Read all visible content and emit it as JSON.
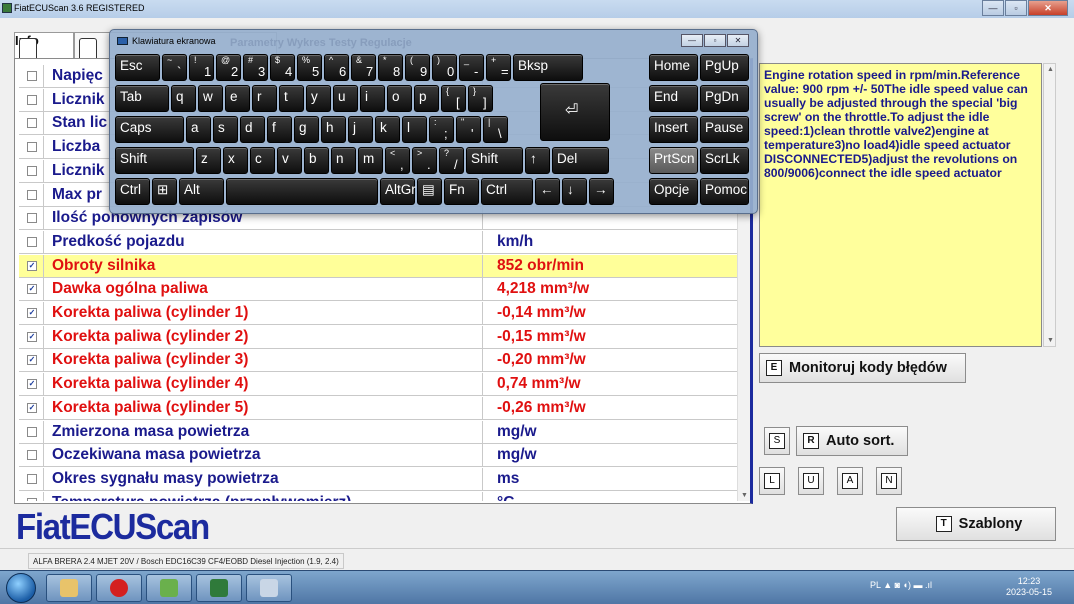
{
  "window": {
    "title": "FiatECUScan 3.6 REGISTERED",
    "controls": {
      "minimize": "—",
      "maximize": "▫",
      "close": "✕"
    }
  },
  "tabs": [
    {
      "key": "F2",
      "label": "Info"
    },
    {
      "key": "F3",
      "label": ""
    }
  ],
  "ghost_tabs": "Parametry   Wykres   Testy   Regulacje",
  "table": {
    "rows": [
      {
        "checked": false,
        "name": "Napięc",
        "value": ""
      },
      {
        "checked": false,
        "name": "Licznik",
        "value": ""
      },
      {
        "checked": false,
        "name": "Stan lic",
        "value": ""
      },
      {
        "checked": false,
        "name": "Liczba",
        "value": ""
      },
      {
        "checked": false,
        "name": "Licznik",
        "value": ""
      },
      {
        "checked": false,
        "name": "Max pr",
        "value": ""
      },
      {
        "checked": false,
        "name": "Ilość ponownych zapisów",
        "value": ""
      },
      {
        "checked": false,
        "name": "Predkość pojazdu",
        "value": "km/h"
      },
      {
        "checked": true,
        "name": "Obroty silnika",
        "value": "852 obr/min",
        "selected": true
      },
      {
        "checked": true,
        "name": "Dawka ogólna paliwa",
        "value": "4,218 mm³/w"
      },
      {
        "checked": true,
        "name": "Korekta paliwa (cylinder 1)",
        "value": "-0,14 mm³/w"
      },
      {
        "checked": true,
        "name": "Korekta paliwa (cylinder 2)",
        "value": "-0,15 mm³/w"
      },
      {
        "checked": true,
        "name": "Korekta paliwa (cylinder 3)",
        "value": "-0,20 mm³/w"
      },
      {
        "checked": true,
        "name": "Korekta paliwa (cylinder 4)",
        "value": "0,74 mm³/w"
      },
      {
        "checked": true,
        "name": "Korekta paliwa (cylinder 5)",
        "value": "-0,26 mm³/w"
      },
      {
        "checked": false,
        "name": "Zmierzona masa powietrza",
        "value": "mg/w"
      },
      {
        "checked": false,
        "name": "Oczekiwana masa powietrza",
        "value": "mg/w"
      },
      {
        "checked": false,
        "name": "Okres sygnału masy powietrza",
        "value": "ms"
      },
      {
        "checked": false,
        "name": "Temperatura powietrza (przepływomierz)",
        "value": "°C"
      }
    ]
  },
  "info_text": "Engine rotation speed in rpm/min.Reference value: 900 rpm +/- 50The idle speed value can usually be adjusted through the special 'big screw' on the throttle.To adjust the idle speed:1)clean throttle valve2)engine at temperature3)no load4)idle speed actuator DISCONNECTED5)adjust the revolutions on 800/9006)connect the idle speed actuator",
  "buttons": {
    "monitor": {
      "key": "E",
      "label": "Monitoruj kody błędów"
    },
    "s": {
      "key": "S"
    },
    "auto_sort": {
      "key": "R",
      "label": "Auto sort."
    },
    "l": {
      "key": "L"
    },
    "u": {
      "key": "U"
    },
    "a": {
      "key": "A"
    },
    "n": {
      "key": "N"
    },
    "templates": {
      "key": "T",
      "label": "Szablony"
    }
  },
  "logo": "FiatECUScan",
  "status": "ALFA BRERA 2.4 MJET 20V / Bosch EDC16C39 CF4/EOBD Diesel Injection (1.9, 2.4)",
  "osk": {
    "title": "Klawiatura ekranowa",
    "keys": {
      "esc": "Esc",
      "tilde_top": "~",
      "tilde": "`",
      "d1_top": "!",
      "d1": "1",
      "d2_top": "@",
      "d2": "2",
      "d3_top": "#",
      "d3": "3",
      "d4_top": "$",
      "d4": "4",
      "d5_top": "%",
      "d5": "5",
      "d6_top": "^",
      "d6": "6",
      "d7_top": "&",
      "d7": "7",
      "d8_top": "*",
      "d8": "8",
      "d9_top": "(",
      "d9": "9",
      "d0_top": ")",
      "d0": "0",
      "minus_top": "_",
      "minus": "-",
      "eq_top": "+",
      "eq": "=",
      "bksp": "Bksp",
      "home": "Home",
      "pgup": "PgUp",
      "tab": "Tab",
      "q": "q",
      "w": "w",
      "e": "e",
      "r": "r",
      "t": "t",
      "y": "y",
      "u": "u",
      "i": "i",
      "o": "o",
      "p": "p",
      "lb_top": "{",
      "lb": "[",
      "rb_top": "}",
      "rb": "]",
      "enter": "⏎",
      "end": "End",
      "pgdn": "PgDn",
      "caps": "Caps",
      "a": "a",
      "s": "s",
      "d": "d",
      "f": "f",
      "g": "g",
      "h": "h",
      "j": "j",
      "k": "k",
      "l": "l",
      "semi_top": ":",
      "semi": ";",
      "quote_top": "\"",
      "quote": "'",
      "bs_top": "|",
      "bs": "\\",
      "insert": "Insert",
      "pause": "Pause",
      "shift": "Shift",
      "z": "z",
      "x": "x",
      "c": "c",
      "v": "v",
      "b": "b",
      "n": "n",
      "m": "m",
      "comma_top": "<",
      "comma": ",",
      "period_top": ">",
      "period": ".",
      "slash_top": "?",
      "slash": "/",
      "rshift": "Shift",
      "up": "↑",
      "del": "Del",
      "prtscn": "PrtScn",
      "scrlk": "ScrLk",
      "ctrl": "Ctrl",
      "win": "⊞",
      "alt": "Alt",
      "space": "",
      "altgr": "AltGr",
      "menu": "▤",
      "fn": "Fn",
      "rctrl": "Ctrl",
      "left": "←",
      "down": "↓",
      "right": "→",
      "options": "Opcje",
      "help": "Pomoc"
    }
  },
  "tray": {
    "lang": "PL",
    "time": "12:23",
    "date": "2023-05-15"
  }
}
